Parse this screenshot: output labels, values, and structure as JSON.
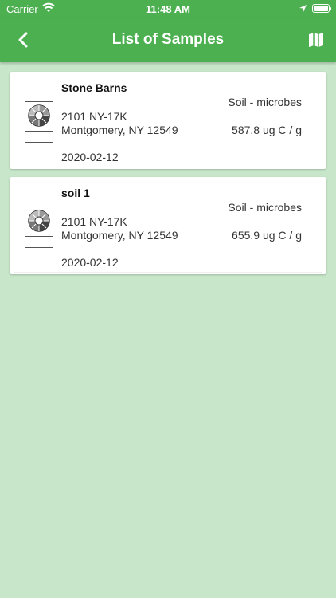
{
  "status_bar": {
    "carrier": "Carrier",
    "time": "11:48 AM"
  },
  "nav": {
    "title": "List of Samples",
    "back_icon": "chevron-left-icon",
    "map_icon": "map-icon"
  },
  "samples": [
    {
      "name": "Stone Barns",
      "type": "Soil - microbes",
      "address_line1": "2101 NY-17K",
      "address_line2": "Montgomery, NY 12549",
      "value": "587.8 ug C / g",
      "date": "2020-02-12"
    },
    {
      "name": "soil 1",
      "type": "Soil - microbes",
      "address_line1": "2101 NY-17K",
      "address_line2": "Montgomery, NY 12549",
      "value": "655.9 ug C / g",
      "date": "2020-02-12"
    }
  ],
  "colors": {
    "header": "#4caf50",
    "background": "#c8e6ca"
  }
}
